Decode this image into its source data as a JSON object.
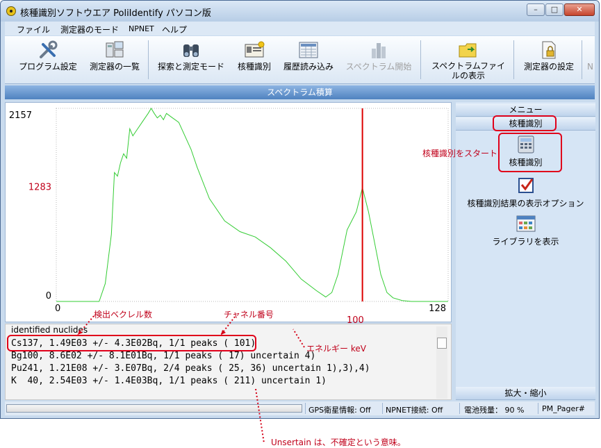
{
  "window": {
    "title": "核種識別ソフトウエア PoliIdentify パソコン版",
    "controls": {
      "minimize": "–",
      "maximize": "□",
      "close": "✕"
    }
  },
  "menubar": [
    "ファイル",
    "測定器のモード",
    "NPNET",
    "ヘルプ"
  ],
  "toolbar": [
    {
      "label": "プログラム設定",
      "icon": "tools-icon",
      "enabled": true
    },
    {
      "label": "測定器の一覧",
      "icon": "device-list-icon",
      "enabled": true
    },
    {
      "label": "探索と測定モード",
      "icon": "binoculars-icon",
      "enabled": true
    },
    {
      "label": "核種識別",
      "icon": "identify-card-icon",
      "enabled": true
    },
    {
      "label": "履歴読み込み",
      "icon": "history-grid-icon",
      "enabled": true
    },
    {
      "label": "スペクトラム開始",
      "icon": "spectrum-bars-icon",
      "enabled": false
    },
    {
      "label": "スペクトラムファイルの表示",
      "label_line1": "スペクトラムファイ",
      "label_line2": "ルの表示",
      "icon": "folder-icon",
      "enabled": true
    },
    {
      "label": "測定器の設定",
      "icon": "locked-document-icon",
      "enabled": true
    }
  ],
  "toolbar_overflow": "N",
  "spectrum_header": "スペクトラム積算",
  "chart_data": {
    "type": "line",
    "y_ticks": [
      "2157",
      "1283",
      "0"
    ],
    "x_ticks": [
      "0",
      "128"
    ],
    "ylim": [
      0,
      2157
    ],
    "xlim": [
      0,
      128
    ],
    "cursor_channel": 100,
    "cursor_label": "100",
    "series": [
      {
        "color": "#33cc33",
        "x": [
          0,
          10,
          14,
          16,
          18,
          19,
          20,
          21,
          22,
          23,
          24,
          25,
          26,
          28,
          30,
          31,
          32,
          33,
          34,
          35,
          36,
          38,
          40,
          42,
          44,
          46,
          50,
          55,
          60,
          65,
          70,
          75,
          80,
          85,
          88,
          90,
          92,
          95,
          98,
          100,
          102,
          104,
          106,
          108,
          110,
          113,
          116,
          120,
          124,
          128
        ],
        "y": [
          0,
          0,
          0,
          200,
          750,
          1440,
          1400,
          1550,
          1650,
          1600,
          1930,
          1850,
          1900,
          2000,
          2100,
          2157,
          2100,
          2050,
          2080,
          2030,
          2100,
          2050,
          2000,
          1850,
          1700,
          1500,
          1150,
          900,
          780,
          720,
          600,
          450,
          250,
          120,
          50,
          100,
          300,
          800,
          1000,
          1270,
          1000,
          650,
          300,
          100,
          40,
          10,
          0,
          0,
          0,
          0
        ]
      }
    ]
  },
  "results": {
    "header": "identified nuclides",
    "lines": [
      "Cs137, 1.49E03 +/- 4.3E02Bq, 1/1 peaks ( 101)",
      "Bg100, 8.6E02 +/- 8.1E01Bq, 1/1 peaks ( 17) uncertain 4)",
      "Pu241, 1.21E08 +/- 3.E07Bq, 2/4 peaks ( 25, 36) uncertain 1),3),4)",
      "K  40, 2.54E03 +/- 1.4E03Bq, 1/1 peaks ( 211) uncertain 1)"
    ]
  },
  "right_panel": {
    "menu_header": "メニュー",
    "section_header": "核種識別",
    "items": [
      {
        "label": "核種識別",
        "icon": "calculator-icon"
      },
      {
        "label": "核種識別結果の表示オプション",
        "icon": "checkbox-icon"
      },
      {
        "label": "ライブラリを表示",
        "icon": "library-grid-icon"
      }
    ],
    "zoom_header": "拡大・縮小"
  },
  "statusbar": {
    "gps": "GPS衛星情報: Off",
    "npnet": "NPNET接続: Off",
    "battery": "電池残量： 90 %",
    "pager": "PM_Pager#"
  },
  "annotations": {
    "start_identify": "核種識別をスタート",
    "becquerel": "検出ベクレル数",
    "channel": "チャネル番号",
    "energy": "エネルギー keV",
    "uncertain": "Unsertain は、不確定という意味。"
  },
  "colors": {
    "accent": "#4f82c0",
    "annotation": "#c0001a",
    "spectrum": "#33cc33",
    "cursor": "#dd0000"
  }
}
